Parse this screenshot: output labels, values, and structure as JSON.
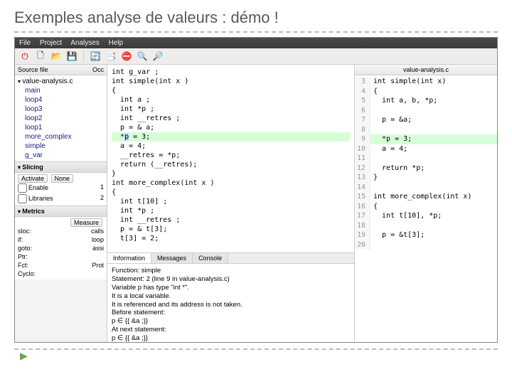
{
  "slide": {
    "title": "Exemples analyse de valeurs : démo !"
  },
  "menu": {
    "file": "File",
    "project": "Project",
    "analyses": "Analyses",
    "help": "Help"
  },
  "icons": {
    "power": "⏻",
    "new": "🗋",
    "open": "📂",
    "save": "💾",
    "refresh": "🔄",
    "copy": "📑",
    "stop": "⛔",
    "zoomout": "🔍",
    "zoomin": "🔎"
  },
  "left": {
    "col1": "Source file",
    "col2": "Occ",
    "root": "value-analysis.c",
    "items": [
      "main",
      "loop4",
      "loop3",
      "loop2",
      "loop1",
      "more_complex",
      "simple",
      "g_var"
    ],
    "slicing": {
      "title": "Slicing",
      "activate": "Activate",
      "none": "None",
      "enable": "Enable",
      "enable_n": "1",
      "libraries": "Libraries",
      "libraries_n": "2"
    },
    "metrics": {
      "title": "Metrics",
      "measure": "Measure",
      "rows": [
        [
          "sloc:",
          "calls"
        ],
        [
          "if:",
          "loop"
        ],
        [
          "goto:",
          "assi"
        ],
        [
          "Ptr:",
          ""
        ],
        [
          "Fct:",
          "Prot"
        ],
        [
          "Cyclo:",
          ""
        ]
      ]
    }
  },
  "center": {
    "code": [
      "int g_var ;",
      "int simple(int x )",
      "{",
      "  int a ;",
      "  int *p ;",
      "  int __retres ;",
      "  p = & a;",
      "  *p = 3;",
      "  a = 4;",
      "  __retres = *p;",
      "  return (__retres);",
      "}",
      "",
      "int more_complex(int x )",
      "{",
      "  int t[10] ;",
      "  int *p ;",
      "  int __retres ;",
      "  p = & t[3];",
      "  t[3] = 2;"
    ],
    "hl_line": 7,
    "sel_text": "p",
    "tabs": {
      "info": "Information",
      "msgs": "Messages",
      "cons": "Console"
    },
    "info": [
      "Function: simple",
      "Statement: 2 (line 9 in value-analysis.c)",
      "Variable p has type \"int *\".",
      "It is a local variable.",
      "It is referenced and its address is not taken.",
      "Before statement:",
      "p ∈ {{ &a ;}}",
      "At next statement:",
      "p ∈ {{ &a ;}}"
    ]
  },
  "right": {
    "file": "value-analysis.c",
    "lines": [
      {
        "n": "3",
        "t": "int simple(int x)"
      },
      {
        "n": "4",
        "t": "{"
      },
      {
        "n": "5",
        "t": "  int a, b, *p;"
      },
      {
        "n": "6",
        "t": ""
      },
      {
        "n": "7",
        "t": "  p = &a;"
      },
      {
        "n": "8",
        "t": ""
      },
      {
        "n": "9",
        "t": "  *p = 3;"
      },
      {
        "n": "10",
        "t": "  a = 4;"
      },
      {
        "n": "11",
        "t": ""
      },
      {
        "n": "12",
        "t": "  return *p;"
      },
      {
        "n": "13",
        "t": "}"
      },
      {
        "n": "14",
        "t": ""
      },
      {
        "n": "15",
        "t": "int more_complex(int x)"
      },
      {
        "n": "16",
        "t": "{"
      },
      {
        "n": "17",
        "t": "  int t[10], *p;"
      },
      {
        "n": "18",
        "t": ""
      },
      {
        "n": "19",
        "t": "  p = &t[3];"
      },
      {
        "n": "20",
        "t": ""
      }
    ],
    "hl_line": "9"
  }
}
